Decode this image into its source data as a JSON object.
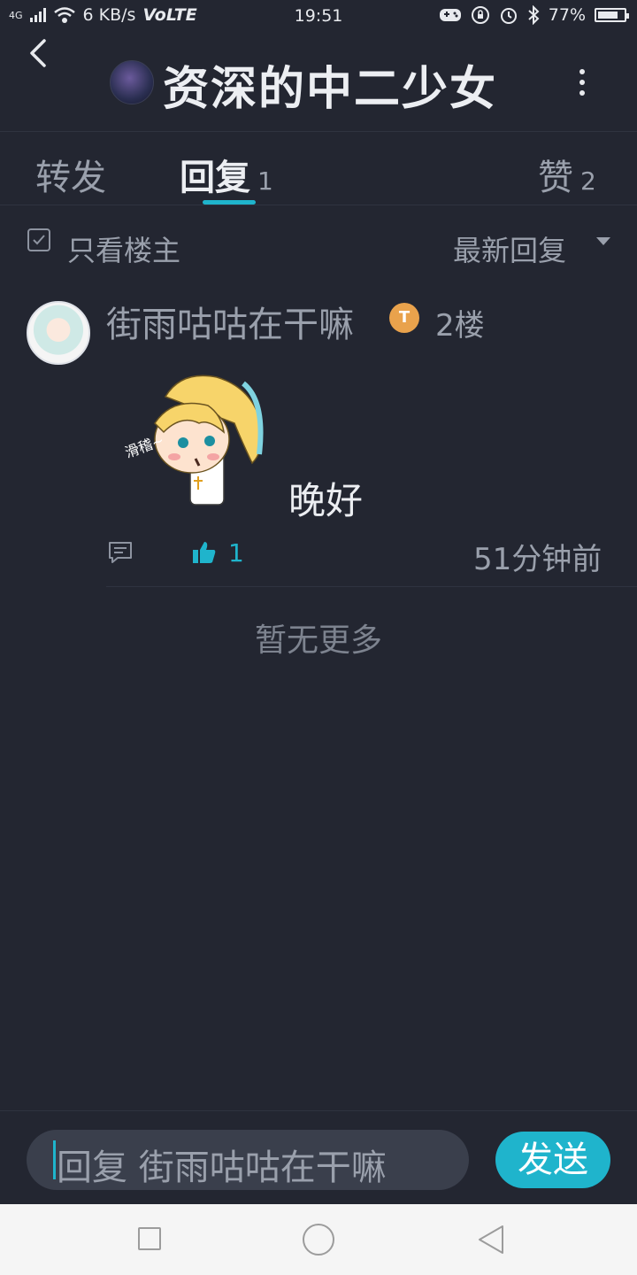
{
  "status_bar": {
    "network": "4G",
    "speed": "6 KB/s",
    "volte": "VoLTE",
    "time": "19:51",
    "battery": "77%",
    "battery_level": 0.77
  },
  "header": {
    "title": "资深的中二少女"
  },
  "tabs": [
    {
      "label": "转发",
      "count": ""
    },
    {
      "label": "回复",
      "count": "1"
    },
    {
      "label": "赞",
      "count": "2"
    }
  ],
  "filter": {
    "only_op_label": "只看楼主",
    "sort_label": "最新回复"
  },
  "post": {
    "username": "街雨咕咕在干嘛",
    "badge": "T",
    "floor": "2楼",
    "sticker_text": "滑稽~",
    "text": "晚好",
    "likes": "1",
    "time": "51分钟前"
  },
  "footer_note": "暂无更多",
  "reply": {
    "placeholder": "回复 街雨咕咕在干嘛",
    "send_label": "发送"
  },
  "colors": {
    "background": "#232631",
    "accent": "#1fb4cc"
  }
}
